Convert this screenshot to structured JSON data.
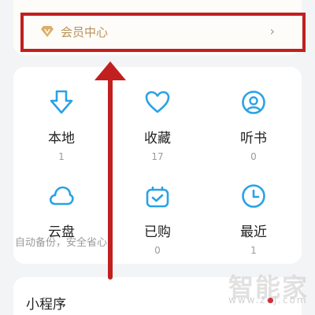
{
  "vip": {
    "label": "会员中心",
    "chevron": "›",
    "icon": "vip-diamond-icon"
  },
  "grid": [
    {
      "label": "本地",
      "count": "1",
      "icon": "download-arrow-icon"
    },
    {
      "label": "收藏",
      "count": "17",
      "icon": "heart-icon"
    },
    {
      "label": "听书",
      "count": "0",
      "icon": "headphone-icon"
    },
    {
      "label": "云盘",
      "count": "",
      "icon": "cloud-icon"
    },
    {
      "label": "已购",
      "count": "0",
      "icon": "purchased-bag-icon"
    },
    {
      "label": "最近",
      "count": "1",
      "icon": "clock-icon"
    }
  ],
  "cloud_sub": "自动备份，安全省心",
  "mini_program": {
    "title": "小程序"
  },
  "watermark": {
    "text": "智能家",
    "url": "www.zoj.com"
  },
  "colors": {
    "accent_blue": "#2aa2e6",
    "vip_gold": "#b8925a",
    "annotation_red": "#c21f1f"
  }
}
